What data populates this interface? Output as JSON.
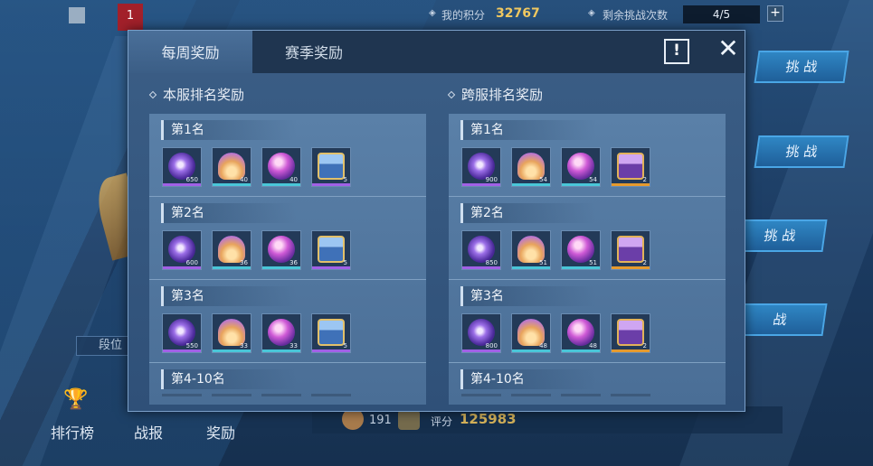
{
  "top_bar": {
    "rank_flag": "1",
    "score_label": "我的积分",
    "score_value": "32767",
    "attempts_label": "剩余挑战次数",
    "attempts_value": "4/5",
    "plus": "+"
  },
  "challenge_buttons": [
    "挑 战",
    "挑 战",
    "挑 战",
    "战"
  ],
  "left_panel": {
    "position_label": "段位"
  },
  "bottom_nav": [
    "排行榜",
    "战报",
    "奖励"
  ],
  "bottom_strip": {
    "level": "191",
    "score_label": "评分",
    "score_value": "125983"
  },
  "modal": {
    "tabs": [
      "每周奖励",
      "赛季奖励"
    ],
    "active_tab": "每周奖励",
    "info_label": "!",
    "close_label": "✕",
    "sections": [
      {
        "title": "本服排名奖励",
        "ranks": [
          {
            "label": "第1名",
            "items": [
              {
                "icon": "purple-orb-icon",
                "count": "650",
                "rarity": "purple"
              },
              {
                "icon": "golden-sand-icon",
                "count": "40",
                "rarity": "cyan"
              },
              {
                "icon": "magic-sphere-icon",
                "count": "40",
                "rarity": "cyan"
              },
              {
                "icon": "blue-chest-icon",
                "count": "5",
                "rarity": "purple"
              }
            ]
          },
          {
            "label": "第2名",
            "items": [
              {
                "icon": "purple-orb-icon",
                "count": "600",
                "rarity": "purple"
              },
              {
                "icon": "golden-sand-icon",
                "count": "36",
                "rarity": "cyan"
              },
              {
                "icon": "magic-sphere-icon",
                "count": "36",
                "rarity": "cyan"
              },
              {
                "icon": "blue-chest-icon",
                "count": "5",
                "rarity": "purple"
              }
            ]
          },
          {
            "label": "第3名",
            "items": [
              {
                "icon": "purple-orb-icon",
                "count": "550",
                "rarity": "purple"
              },
              {
                "icon": "golden-sand-icon",
                "count": "33",
                "rarity": "cyan"
              },
              {
                "icon": "magic-sphere-icon",
                "count": "33",
                "rarity": "cyan"
              },
              {
                "icon": "blue-chest-icon",
                "count": "5",
                "rarity": "purple"
              }
            ]
          },
          {
            "label": "第4-10名",
            "items": []
          }
        ]
      },
      {
        "title": "跨服排名奖励",
        "ranks": [
          {
            "label": "第1名",
            "items": [
              {
                "icon": "purple-orb-icon",
                "count": "900",
                "rarity": "purple"
              },
              {
                "icon": "golden-sand-icon",
                "count": "54",
                "rarity": "cyan"
              },
              {
                "icon": "magic-sphere-icon",
                "count": "54",
                "rarity": "cyan"
              },
              {
                "icon": "purple-chest-icon",
                "count": "2",
                "rarity": "orange"
              }
            ]
          },
          {
            "label": "第2名",
            "items": [
              {
                "icon": "purple-orb-icon",
                "count": "850",
                "rarity": "purple"
              },
              {
                "icon": "golden-sand-icon",
                "count": "51",
                "rarity": "cyan"
              },
              {
                "icon": "magic-sphere-icon",
                "count": "51",
                "rarity": "cyan"
              },
              {
                "icon": "purple-chest-icon",
                "count": "2",
                "rarity": "orange"
              }
            ]
          },
          {
            "label": "第3名",
            "items": [
              {
                "icon": "purple-orb-icon",
                "count": "800",
                "rarity": "purple"
              },
              {
                "icon": "golden-sand-icon",
                "count": "48",
                "rarity": "cyan"
              },
              {
                "icon": "magic-sphere-icon",
                "count": "48",
                "rarity": "cyan"
              },
              {
                "icon": "purple-chest-icon",
                "count": "2",
                "rarity": "orange"
              }
            ]
          },
          {
            "label": "第4-10名",
            "items": []
          }
        ]
      }
    ]
  }
}
